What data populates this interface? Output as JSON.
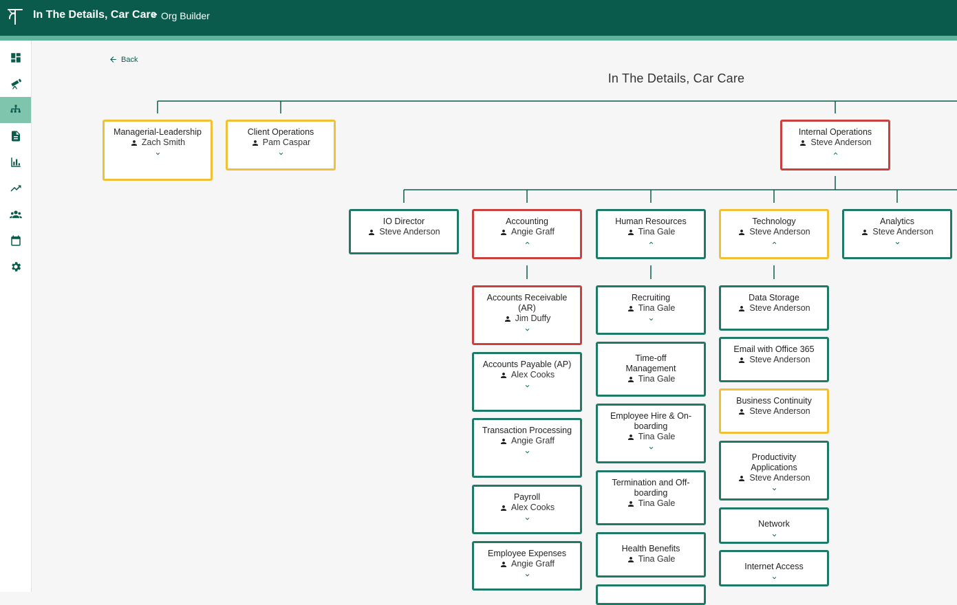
{
  "header": {
    "org_name": "In The Details, Car Care",
    "separator": ">",
    "page": "Org Builder"
  },
  "nav": {
    "back_label": "Back"
  },
  "sidebar": {
    "items": [
      {
        "icon": "dashboard-icon",
        "active": false
      },
      {
        "icon": "telescope-icon",
        "active": false
      },
      {
        "icon": "org-chart-icon",
        "active": true
      },
      {
        "icon": "document-icon",
        "active": false
      },
      {
        "icon": "bar-chart-icon",
        "active": false
      },
      {
        "icon": "trending-up-icon",
        "active": false
      },
      {
        "icon": "people-icon",
        "active": false
      },
      {
        "icon": "calendar-icon",
        "active": false
      },
      {
        "icon": "settings-icon",
        "active": false
      }
    ]
  },
  "org": {
    "title": "In The Details, Car Care",
    "status_colors": {
      "green": "#1e7a66",
      "yellow": "#f0c137",
      "red": "#c9403c"
    },
    "nodes": {
      "managerial": {
        "title": "Managerial-Leadership",
        "person": "Zach Smith",
        "status": "yellow",
        "expanded": false
      },
      "client_ops": {
        "title": "Client Operations",
        "person": "Pam Caspar",
        "status": "yellow",
        "expanded": false
      },
      "internal_ops": {
        "title": "Internal Operations",
        "person": "Steve Anderson",
        "status": "red",
        "expanded": true
      },
      "io_director": {
        "title": "IO Director",
        "person": "Steve Anderson",
        "status": "green"
      },
      "accounting": {
        "title": "Accounting",
        "person": "Angie Graff",
        "status": "red",
        "expanded": true
      },
      "human_resources": {
        "title": "Human Resources",
        "person": "Tina Gale",
        "status": "green",
        "expanded": true
      },
      "technology": {
        "title": "Technology",
        "person": "Steve Anderson",
        "status": "yellow",
        "expanded": true
      },
      "analytics": {
        "title": "Analytics",
        "person": "Steve Anderson",
        "status": "green",
        "expanded": false
      },
      "ar": {
        "title": "Accounts Receivable (AR)",
        "person": "Jim Duffy",
        "status": "red",
        "expanded": false
      },
      "ap": {
        "title": "Accounts Payable (AP)",
        "person": "Alex Cooks",
        "status": "green",
        "expanded": false
      },
      "transaction": {
        "title": "Transaction Processing",
        "person": "Angie Graff",
        "status": "green",
        "expanded": false
      },
      "payroll": {
        "title": "Payroll",
        "person": "Alex Cooks",
        "status": "green",
        "expanded": false
      },
      "employee_expenses": {
        "title": "Employee Expenses",
        "person": "Angie Graff",
        "status": "green",
        "expanded": false
      },
      "recruiting": {
        "title": "Recruiting",
        "person": "Tina Gale",
        "status": "green",
        "expanded": false
      },
      "time_off": {
        "title": "Time-off Management",
        "person": "Tina Gale",
        "status": "green"
      },
      "hire_onboarding": {
        "title": "Employee Hire & On-boarding",
        "person": "Tina Gale",
        "status": "green",
        "expanded": false
      },
      "termination": {
        "title": "Termination and Off-boarding",
        "person": "Tina Gale",
        "status": "green"
      },
      "health_benefits": {
        "title": "Health Benefits",
        "person": "Tina Gale",
        "status": "green"
      },
      "data_storage": {
        "title": "Data Storage",
        "person": "Steve Anderson",
        "status": "green"
      },
      "email_365": {
        "title": "Email with Office 365",
        "person": "Steve Anderson",
        "status": "green"
      },
      "business_continuity": {
        "title": "Business Continuity",
        "person": "Steve Anderson",
        "status": "yellow"
      },
      "productivity_apps": {
        "title": "Productivity Applications",
        "person": "Steve Anderson",
        "status": "green",
        "expanded": false
      },
      "network": {
        "title": "Network",
        "status": "green",
        "expanded": false
      },
      "internet_access": {
        "title": "Internet Access",
        "status": "green",
        "expanded": false
      }
    }
  }
}
